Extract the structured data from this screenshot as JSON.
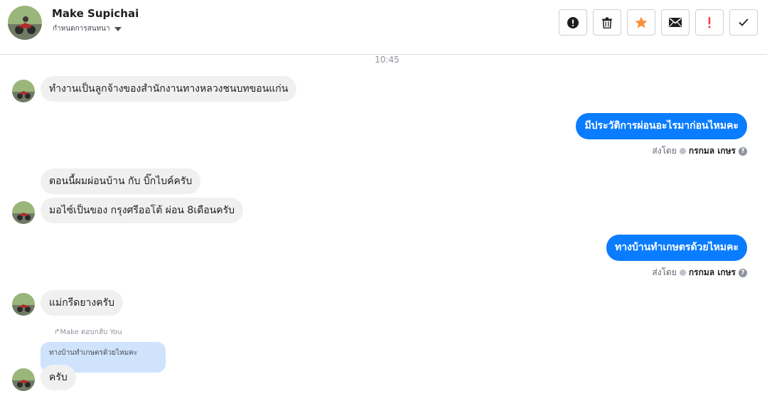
{
  "header": {
    "name": "Make Supichai",
    "subtitle": "กำหนดการสนทนา"
  },
  "actions": [
    {
      "name": "info-button",
      "icon": "exclamation-circle-icon"
    },
    {
      "name": "delete-button",
      "icon": "trash-icon"
    },
    {
      "name": "star-button",
      "icon": "star-icon"
    },
    {
      "name": "mail-button",
      "icon": "envelope-icon"
    },
    {
      "name": "spam-button",
      "icon": "exclamation-icon"
    },
    {
      "name": "done-button",
      "icon": "check-icon"
    }
  ],
  "conversation": {
    "time": "10:45",
    "messages": {
      "m1": "ทำงานเป็นลูกจ้างของสำนักงานทางหลวงชนบทขอนแก่น",
      "m2": "มีประวัติการผ่อนอะไรมาก่อนไหมคะ",
      "m3": "ตอนนี้ผมผ่อนบ้าน กับ บิ๊กไบค์ครับ",
      "m4": "มอไซ์เป็นของ กรุงศรีออโต้ ผ่อน 8เดือนครับ",
      "m5": "ทางบ้านทำเกษตรด้วยไหมคะ",
      "m6": "แม่กรีดยางครับ",
      "m7": "ครับ"
    },
    "sent_by_label": "ส่งโดย",
    "sender": "กรกมล เกษร",
    "reply_label": "Make ตอบกลับ You",
    "quoted_text": "ทางบ้านทำเกษตรด้วยไหมคะ"
  },
  "colors": {
    "outgoing": "#0a7cff",
    "incoming": "#f0f0f0",
    "quote": "#cfe3fd",
    "star": "#f7923b",
    "spam": "#fa383e"
  }
}
